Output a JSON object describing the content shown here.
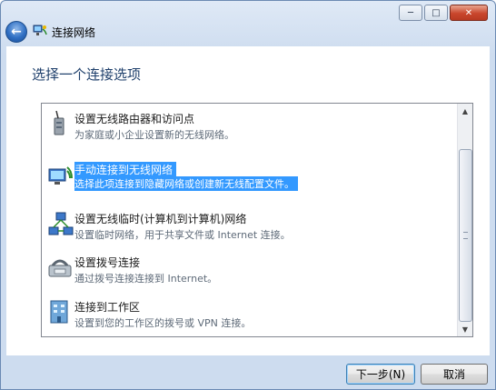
{
  "window": {
    "title": "连接网络",
    "back_icon": "back-arrow-icon",
    "buttons": {
      "minimize": "minimize-icon",
      "maximize": "maximize-icon",
      "close": "close-icon"
    }
  },
  "main": {
    "heading": "选择一个连接选项",
    "options": [
      {
        "title": "设置无线路由器和访问点",
        "desc": "为家庭或小企业设置新的无线网络。",
        "icon": "wireless-router-icon",
        "selected": false
      },
      {
        "title": "手动连接到无线网络",
        "desc": "选择此项连接到隐藏网络或创建新无线配置文件。",
        "icon": "wireless-network-icon",
        "selected": true
      },
      {
        "title": "设置无线临时(计算机到计算机)网络",
        "desc": "设置临时网络，用于共享文件或 Internet 连接。",
        "icon": "adhoc-network-icon",
        "selected": false
      },
      {
        "title": "设置拨号连接",
        "desc": "通过拨号连接连接到 Internet。",
        "icon": "dialup-modem-icon",
        "selected": false
      },
      {
        "title": "连接到工作区",
        "desc": "设置到您的工作区的拨号或 VPN 连接。",
        "icon": "workplace-vpn-icon",
        "selected": false
      }
    ]
  },
  "footer": {
    "next_label": "下一步(N)",
    "cancel_label": "取消"
  },
  "colors": {
    "selection": "#3399ff",
    "heading": "#1e3f6b"
  }
}
